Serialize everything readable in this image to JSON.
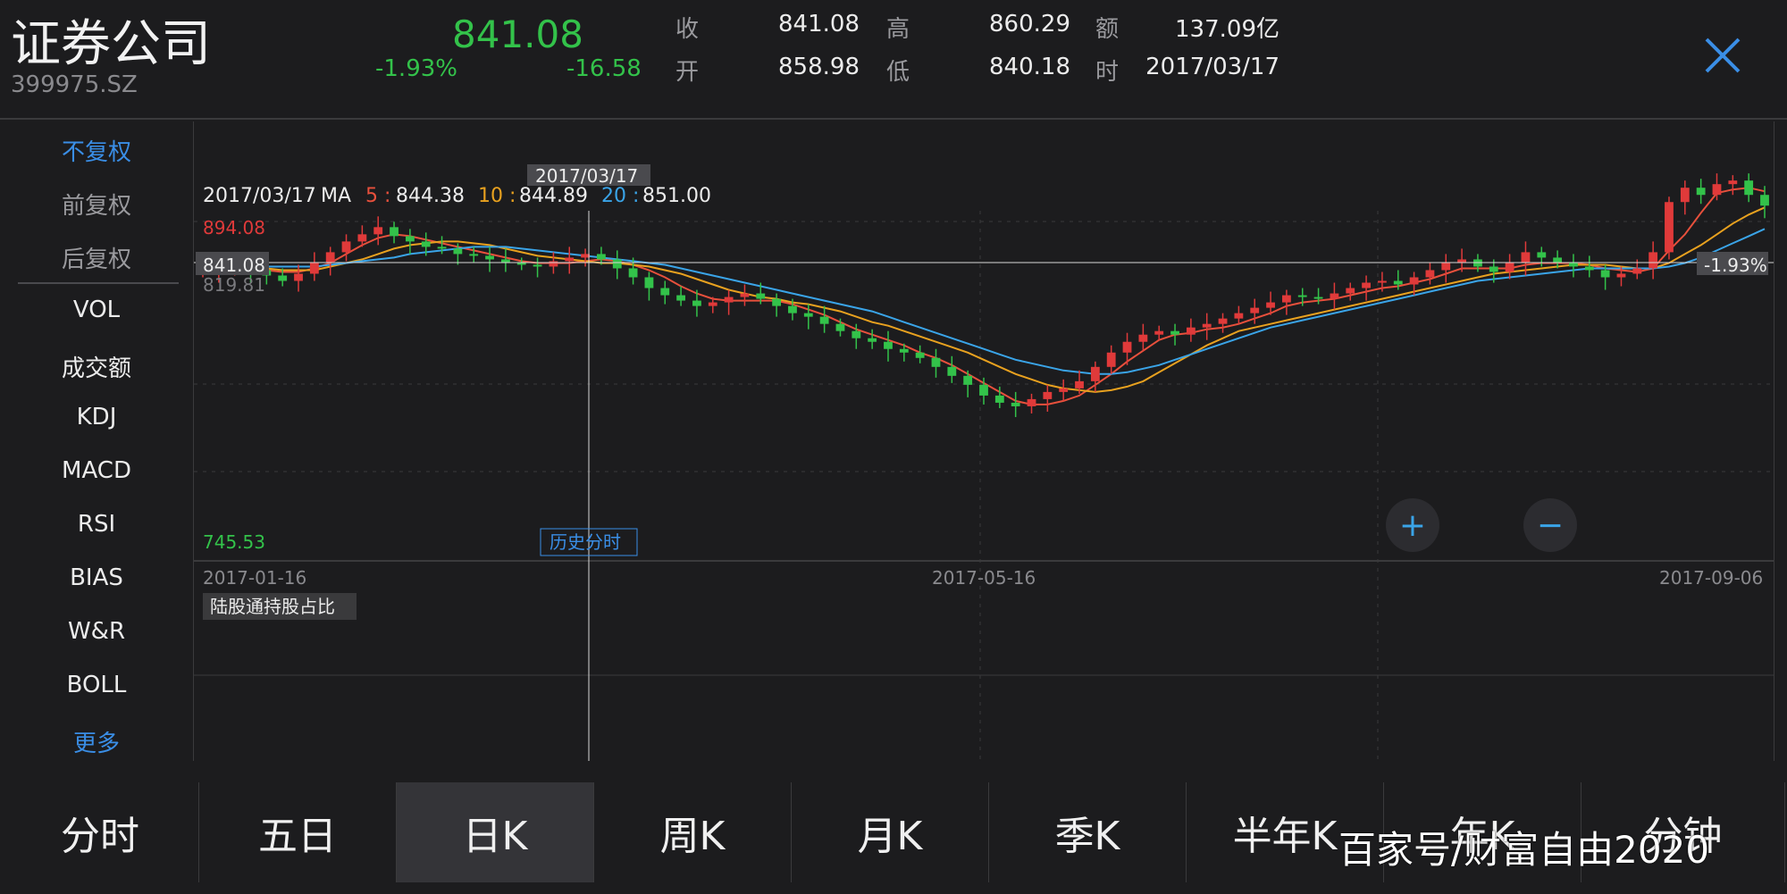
{
  "header": {
    "name": "证券公司",
    "code": "399975.SZ",
    "price": "841.08",
    "pct": "-1.93%",
    "change": "-16.58",
    "quote": [
      {
        "label": "收",
        "value": "841.08"
      },
      {
        "label": "高",
        "value": "860.29"
      },
      {
        "label": "额",
        "value": "137.09亿"
      },
      {
        "label": "开",
        "value": "858.98"
      },
      {
        "label": "低",
        "value": "840.18"
      },
      {
        "label": "时",
        "value": "2017/03/17"
      }
    ]
  },
  "sidebar": {
    "items": [
      "不复权",
      "前复权",
      "后复权",
      "VOL",
      "成交额",
      "KDJ",
      "MACD",
      "RSI",
      "BIAS",
      "W&R",
      "BOLL",
      "更多"
    ]
  },
  "chart": {
    "info_date": "2017/03/17",
    "ma_label": "MA",
    "ma5_key": "5 :",
    "ma5_value": "844.38",
    "ma10_key": "10 :",
    "ma10_value": "844.89",
    "ma20_key": "20 :",
    "ma20_value": "851.00",
    "cursor_date": "2017/03/17",
    "max_label": "894.08",
    "min_label": "745.53",
    "price_tag": "841.08",
    "sub_price": "819.81",
    "pct_tag": "-1.93%",
    "history_btn": "历史分时",
    "dates": [
      "2017-01-16",
      "2017-05-16",
      "2017-09-06"
    ],
    "subpanel_label": "陆股通持股占比",
    "zoom_in": "+",
    "zoom_out": "−"
  },
  "colors": {
    "up": "#e03a3a",
    "down": "#33c24a",
    "ma5": "#e8503c",
    "ma10": "#e8a11f",
    "ma20": "#3aa4e8",
    "accent": "#3a8ee6"
  },
  "tabs": [
    "分时",
    "五日",
    "日K",
    "周K",
    "月K",
    "季K",
    "半年K",
    "年K",
    "分钟"
  ],
  "active_tab": "日K",
  "watermark": "百家号/财富自由2020",
  "chart_data": {
    "type": "candlestick",
    "ylim": [
      745.53,
      894.08
    ],
    "x_start": "2017-01-16",
    "x_end": "2017-09-06",
    "close_series": [
      841,
      843,
      845,
      842,
      839,
      836,
      840,
      846,
      852,
      858,
      862,
      866,
      861,
      858,
      855,
      854,
      851,
      850,
      848,
      846,
      845,
      844,
      847,
      849,
      851,
      848,
      843,
      838,
      832,
      828,
      825,
      822,
      824,
      827,
      829,
      826,
      822,
      818,
      816,
      812,
      808,
      804,
      802,
      798,
      796,
      793,
      788,
      783,
      778,
      772,
      768,
      766,
      770,
      774,
      776,
      780,
      788,
      796,
      802,
      806,
      808,
      806,
      810,
      812,
      815,
      818,
      821,
      824,
      828,
      827,
      826,
      829,
      832,
      835,
      836,
      834,
      838,
      842,
      846,
      848,
      844,
      841,
      846,
      852,
      849,
      846,
      844,
      842,
      838,
      840,
      843,
      852,
      880,
      888,
      884,
      890,
      892,
      884,
      878
    ],
    "ma5_series": [
      842,
      843,
      843,
      843,
      842,
      841,
      841,
      843,
      846,
      851,
      856,
      860,
      862,
      861,
      859,
      857,
      855,
      853,
      851,
      849,
      847,
      846,
      846,
      846,
      847,
      848,
      847,
      845,
      842,
      838,
      833,
      829,
      826,
      825,
      825,
      825,
      825,
      823,
      820,
      817,
      813,
      809,
      806,
      803,
      800,
      796,
      793,
      789,
      784,
      779,
      774,
      769,
      767,
      767,
      769,
      772,
      778,
      784,
      791,
      797,
      803,
      806,
      807,
      809,
      810,
      812,
      815,
      818,
      822,
      824,
      825,
      826,
      828,
      830,
      832,
      833,
      835,
      837,
      840,
      843,
      843,
      843,
      843,
      845,
      846,
      846,
      846,
      845,
      843,
      842,
      841,
      843,
      853,
      862,
      874,
      885,
      887,
      888,
      886
    ],
    "ma10_series": [
      843,
      843,
      843,
      843,
      843,
      842,
      842,
      842,
      844,
      846,
      848,
      851,
      854,
      856,
      857,
      858,
      858,
      857,
      856,
      854,
      852,
      850,
      849,
      848,
      847,
      846,
      846,
      845,
      844,
      842,
      840,
      837,
      834,
      831,
      829,
      827,
      826,
      824,
      823,
      821,
      819,
      816,
      813,
      811,
      808,
      805,
      802,
      799,
      796,
      792,
      788,
      784,
      781,
      778,
      776,
      775,
      774,
      775,
      777,
      780,
      785,
      790,
      795,
      800,
      804,
      808,
      810,
      812,
      814,
      816,
      818,
      820,
      822,
      824,
      826,
      828,
      830,
      832,
      834,
      836,
      838,
      840,
      841,
      842,
      843,
      844,
      845,
      845,
      845,
      844,
      843,
      843,
      846,
      851,
      856,
      862,
      868,
      873,
      877
    ],
    "ma20_series": [
      844,
      844,
      844,
      844,
      844,
      844,
      844,
      844,
      845,
      846,
      847,
      848,
      849,
      851,
      852,
      853,
      854,
      855,
      855,
      855,
      854,
      853,
      852,
      851,
      850,
      849,
      848,
      847,
      846,
      845,
      843,
      841,
      839,
      837,
      835,
      833,
      831,
      829,
      827,
      825,
      823,
      821,
      819,
      816,
      813,
      810,
      807,
      804,
      801,
      798,
      795,
      792,
      790,
      788,
      786,
      785,
      784,
      784,
      785,
      787,
      789,
      792,
      795,
      798,
      801,
      804,
      807,
      810,
      812,
      814,
      816,
      818,
      820,
      822,
      824,
      826,
      828,
      830,
      832,
      834,
      836,
      837,
      838,
      839,
      840,
      841,
      842,
      843,
      843,
      843,
      843,
      843,
      844,
      846,
      849,
      853,
      857,
      861,
      865
    ]
  }
}
